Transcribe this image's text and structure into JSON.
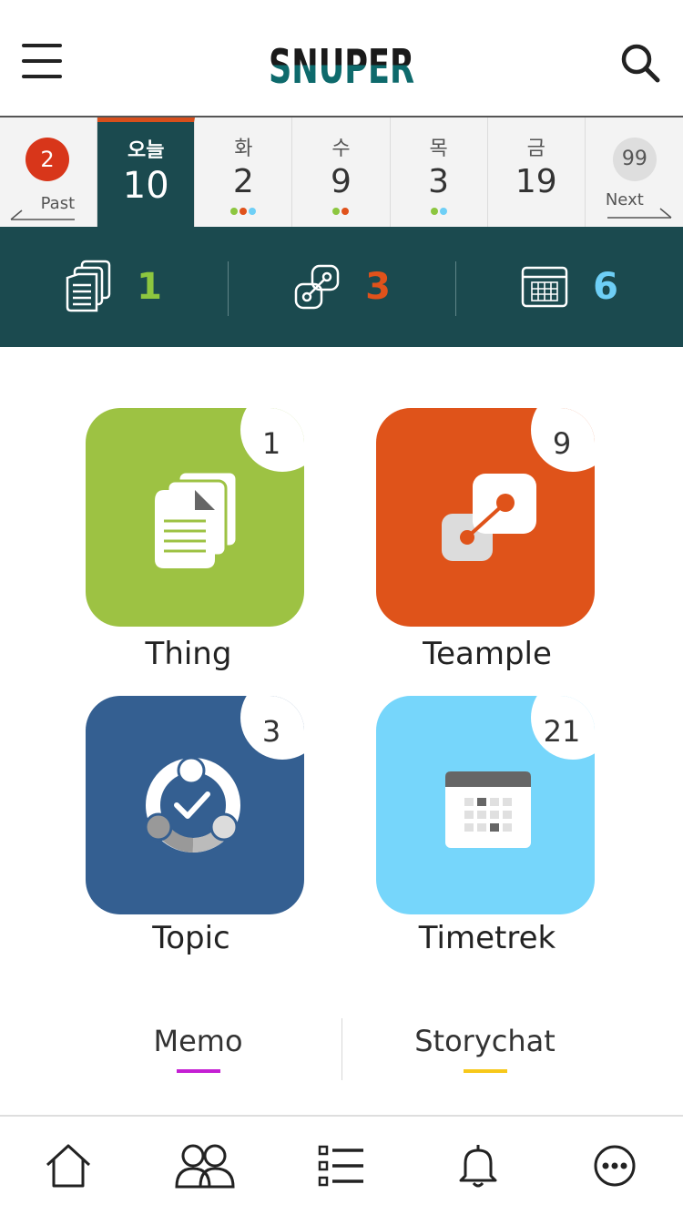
{
  "header": {
    "logo_text": "SNUPER",
    "menu_icon": "hamburger-menu-icon",
    "search_icon": "search-icon"
  },
  "date_strip": {
    "past": {
      "count": "2",
      "label": "Past"
    },
    "days": [
      {
        "name": "오늘",
        "number": "10",
        "today": true,
        "dots": []
      },
      {
        "name": "화",
        "number": "2",
        "dots": [
          "#8cc63f",
          "#e0521b",
          "#6ecff6"
        ]
      },
      {
        "name": "수",
        "number": "9",
        "dots": [
          "#8cc63f",
          "#e0521b"
        ]
      },
      {
        "name": "목",
        "number": "3",
        "dots": [
          "#8cc63f",
          "#6ecff6"
        ]
      },
      {
        "name": "금",
        "number": "19",
        "dots": []
      }
    ],
    "next": {
      "count": "99",
      "label": "Next"
    }
  },
  "stats": [
    {
      "icon": "documents-icon",
      "value": "1",
      "color": "#8dc63f"
    },
    {
      "icon": "link-icon",
      "value": "3",
      "color": "#e0521b"
    },
    {
      "icon": "calendar-icon",
      "value": "6",
      "color": "#6ecff6"
    }
  ],
  "tiles": [
    {
      "label": "Thing",
      "badge": "1",
      "color": "#9dc243",
      "icon": "documents-icon"
    },
    {
      "label": "Teample",
      "badge": "9",
      "color": "#df531a",
      "icon": "link-icon"
    },
    {
      "label": "Topic",
      "badge": "3",
      "color": "#345f91",
      "icon": "team-check-icon"
    },
    {
      "label": "Timetrek",
      "badge": "21",
      "color": "#76d6fb",
      "icon": "calendar-icon"
    }
  ],
  "tabs": [
    {
      "label": "Memo",
      "underline_color": "#c41fd3"
    },
    {
      "label": "Storychat",
      "underline_color": "#f7c81a"
    }
  ],
  "bottom_nav": [
    {
      "icon": "home-icon"
    },
    {
      "icon": "people-icon"
    },
    {
      "icon": "list-icon"
    },
    {
      "icon": "bell-icon"
    },
    {
      "icon": "more-icon"
    }
  ]
}
